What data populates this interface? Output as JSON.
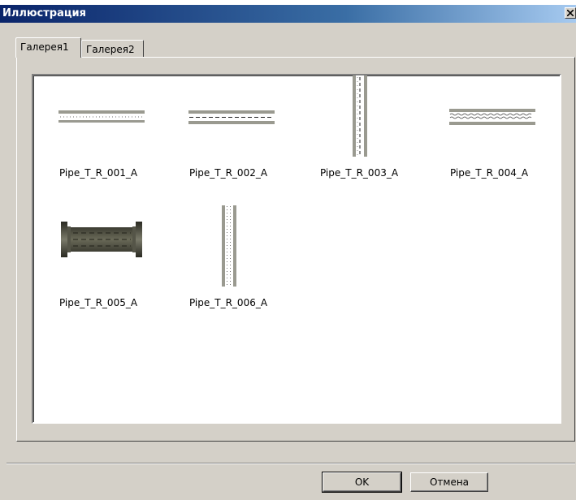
{
  "window": {
    "title": "Иллюстрация",
    "close_glyph": "✕"
  },
  "tabs": [
    {
      "label": "Галерея1",
      "active": true
    },
    {
      "label": "Галерея2",
      "active": false
    }
  ],
  "gallery": {
    "items": [
      {
        "label": "Pipe_T_R_001_A",
        "icon": "pipe-horizontal-dotted-icon"
      },
      {
        "label": "Pipe_T_R_002_A",
        "icon": "pipe-horizontal-dashed-icon"
      },
      {
        "label": "Pipe_T_R_003_A",
        "icon": "pipe-vertical-dashed-icon"
      },
      {
        "label": "Pipe_T_R_004_A",
        "icon": "pipe-horizontal-wavy-icon"
      },
      {
        "label": "Pipe_T_R_005_A",
        "icon": "pipe-flanged-icon"
      },
      {
        "label": "Pipe_T_R_006_A",
        "icon": "pipe-vertical-dotted-icon"
      }
    ]
  },
  "buttons": {
    "ok": "OK",
    "cancel": "Отмена"
  }
}
